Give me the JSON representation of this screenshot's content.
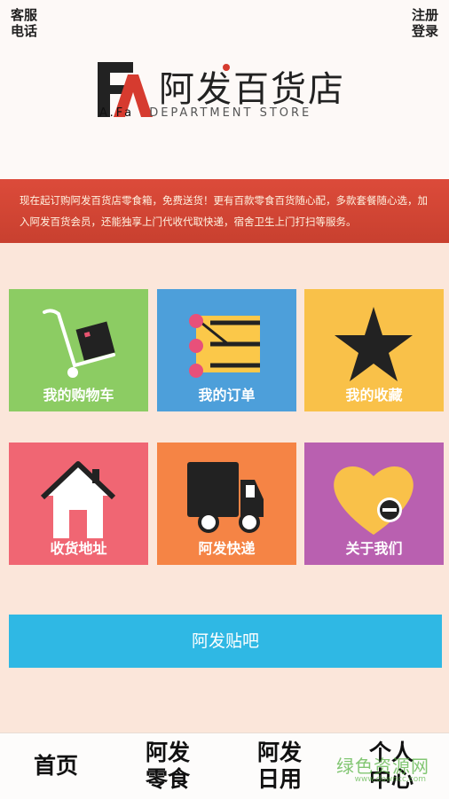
{
  "header": {
    "service_line1": "客服",
    "service_line2": "电话",
    "register_line1": "注册",
    "register_line2": "登录"
  },
  "logo": {
    "name_cn": "阿发百货店",
    "prefix_en": "A.Fa",
    "name_en": "DEPARTMENT STORE"
  },
  "notice": {
    "text": "现在起订购阿发百货店零食箱，免费送货！更有百款零食百货随心配，多款套餐随心选，加入阿发百货会员，还能独享上门代收代取快递，宿舍卫生上门打扫等服务。"
  },
  "tiles": [
    {
      "label": "我的购物车",
      "color": "#8ccc63",
      "icon": "shopping-cart-icon"
    },
    {
      "label": "我的订单",
      "color": "#4d9fda",
      "icon": "order-list-icon"
    },
    {
      "label": "我的收藏",
      "color": "#f9c149",
      "icon": "star-icon"
    },
    {
      "label": "收货地址",
      "color": "#f06673",
      "icon": "house-icon"
    },
    {
      "label": "阿发快递",
      "color": "#f58445",
      "icon": "truck-icon"
    },
    {
      "label": "关于我们",
      "color": "#b960b0",
      "icon": "heart-icon"
    }
  ],
  "forum_button": {
    "label": "阿发贴吧",
    "color": "#2fb8e4"
  },
  "bottom_nav": [
    {
      "line1": "首页",
      "line2": ""
    },
    {
      "line1": "阿发",
      "line2": "零食"
    },
    {
      "line1": "阿发",
      "line2": "日用"
    },
    {
      "line1": "个人",
      "line2": "中心"
    }
  ],
  "watermark": {
    "text": "绿色资源网",
    "sub": "www.downcc.com"
  }
}
